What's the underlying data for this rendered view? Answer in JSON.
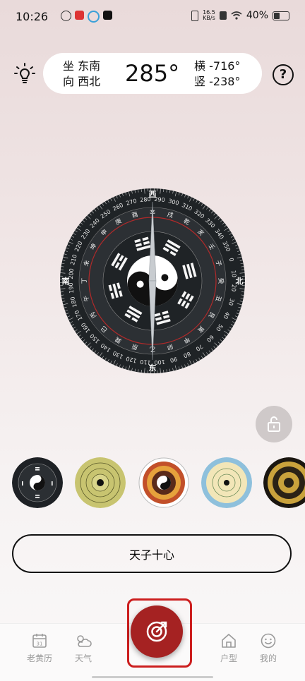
{
  "status_bar": {
    "time": "10:26",
    "net_speed_value": "16.5",
    "net_speed_unit": "KB/s",
    "battery": "40%"
  },
  "reading": {
    "sit_label": "坐",
    "sit_dir": "东南",
    "face_label": "向",
    "face_dir": "西北",
    "degree": "285°",
    "horiz_label": "横",
    "horiz_val": "-716°",
    "vert_label": "竖",
    "vert_val": "-238°"
  },
  "compass": {
    "dirs": [
      "西",
      "北",
      "东",
      "南"
    ],
    "degree_labels": [
      "0",
      "10",
      "20",
      "30",
      "40",
      "50",
      "60",
      "70",
      "80",
      "90",
      "100",
      "110",
      "120",
      "130",
      "140",
      "150",
      "160",
      "170",
      "180",
      "190",
      "200",
      "210",
      "220",
      "230",
      "240",
      "250",
      "260",
      "270",
      "280",
      "290",
      "300",
      "310",
      "320",
      "330",
      "340",
      "350"
    ],
    "mountains": [
      "子",
      "癸",
      "丑",
      "艮",
      "寅",
      "甲",
      "卯",
      "乙",
      "辰",
      "巽",
      "巳",
      "丙",
      "午",
      "丁",
      "未",
      "坤",
      "申",
      "庚",
      "酉",
      "辛",
      "戌",
      "乾",
      "亥",
      "壬"
    ],
    "rotation_deg": 285,
    "colors": {
      "face": "#1f2326",
      "ring": "#2c3034",
      "red_ring": "#b02a2a",
      "needle": "#9aa0a6"
    }
  },
  "thumbnails": [
    {
      "name": "bagua-dark"
    },
    {
      "name": "luopan-olive"
    },
    {
      "name": "luopan-orange"
    },
    {
      "name": "luopan-blue"
    },
    {
      "name": "luopan-gold"
    }
  ],
  "selected_style": "天子十心",
  "nav": {
    "items": [
      {
        "label": "老黄历",
        "calendar_day": "31"
      },
      {
        "label": "天气"
      },
      {
        "label": "户型"
      },
      {
        "label": "我的"
      }
    ]
  },
  "accent": "#a52222"
}
